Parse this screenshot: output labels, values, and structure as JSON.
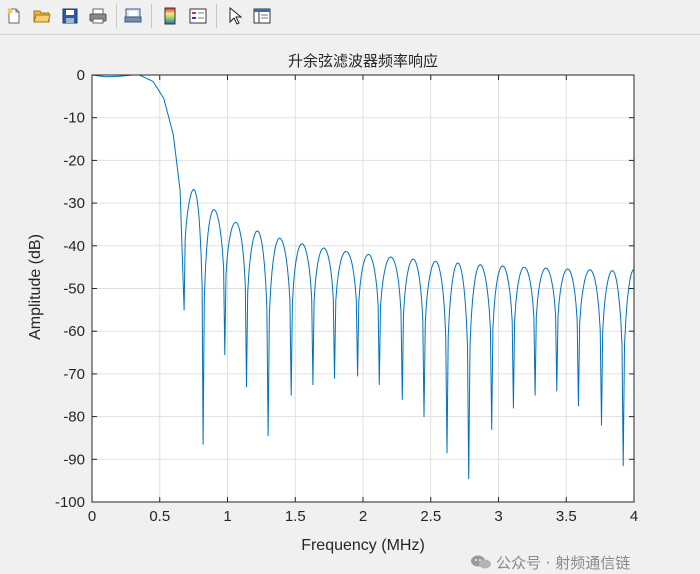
{
  "toolbar": {
    "icons": [
      "new-figure-icon",
      "open-file-icon",
      "save-icon",
      "print-icon",
      "print-preview-icon",
      "colorbar-icon",
      "legend-icon",
      "pointer-icon",
      "property-editor-icon"
    ]
  },
  "watermark": {
    "text": "公众号 · 射频通信链"
  },
  "chart_data": {
    "type": "line",
    "title": "升余弦滤波器频率响应",
    "xlabel": "Frequency (MHz)",
    "ylabel": "Amplitude (dB)",
    "xlim": [
      0,
      4
    ],
    "ylim": [
      -100,
      0
    ],
    "xticks": [
      0,
      0.5,
      1,
      1.5,
      2,
      2.5,
      3,
      3.5,
      4
    ],
    "xtick_labels": [
      "0",
      "0.5",
      "1",
      "1.5",
      "2",
      "2.5",
      "3",
      "3.5",
      "4"
    ],
    "yticks": [
      0,
      -10,
      -20,
      -30,
      -40,
      -50,
      -60,
      -70,
      -80,
      -90,
      -100
    ],
    "ytick_labels": [
      "0",
      "-10",
      "-20",
      "-30",
      "-40",
      "-50",
      "-60",
      "-70",
      "-80",
      "-90",
      "-100"
    ],
    "grid": true,
    "line_color": "#0072bd",
    "passband": [
      [
        0,
        0
      ],
      [
        0.1,
        -0.4
      ],
      [
        0.2,
        -0.3
      ],
      [
        0.3,
        0
      ],
      [
        0.35,
        0
      ],
      [
        0.45,
        -1.5
      ],
      [
        0.53,
        -5.5
      ],
      [
        0.6,
        -14
      ],
      [
        0.65,
        -27
      ],
      [
        0.68,
        -55
      ]
    ],
    "nulls": [
      [
        0.68,
        -55
      ],
      [
        0.82,
        -86.5
      ],
      [
        0.98,
        -65.5
      ],
      [
        1.14,
        -73
      ],
      [
        1.3,
        -84.5
      ],
      [
        1.47,
        -75
      ],
      [
        1.63,
        -72.5
      ],
      [
        1.79,
        -71
      ],
      [
        1.96,
        -70.5
      ],
      [
        2.12,
        -72.5
      ],
      [
        2.29,
        -76
      ],
      [
        2.45,
        -80
      ],
      [
        2.62,
        -88.5
      ],
      [
        2.78,
        -94.5
      ],
      [
        2.95,
        -83
      ],
      [
        3.11,
        -78
      ],
      [
        3.27,
        -75
      ],
      [
        3.43,
        -74
      ],
      [
        3.59,
        -77.5
      ],
      [
        3.76,
        -82
      ],
      [
        3.92,
        -91.5
      ]
    ],
    "peaks": [
      -26.8,
      -31.5,
      -34.5,
      -36.5,
      -38.2,
      -39.5,
      -40.5,
      -41.3,
      -42,
      -42.6,
      -43.1,
      -43.6,
      -44,
      -44.4,
      -44.7,
      -45,
      -45.2,
      -45.4,
      -45.6,
      -45.8
    ],
    "end_point": [
      4,
      -45.5
    ]
  }
}
